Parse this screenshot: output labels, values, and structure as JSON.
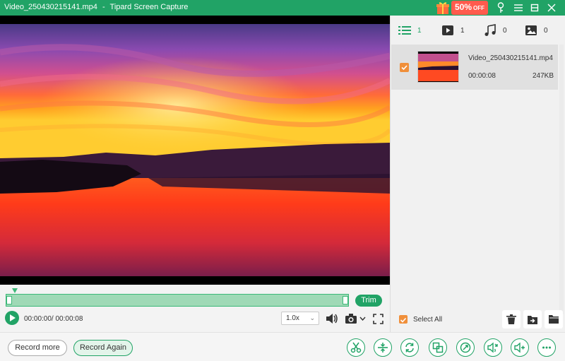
{
  "window": {
    "file_name": "Video_250430215141.mp4",
    "separator": "-",
    "app_name": "Tipard Screen Capture",
    "promo_text": "50%",
    "promo_suffix": "OFF",
    "accent_color": "#21a366"
  },
  "player": {
    "time_display": "00:00:00/ 00:00:08",
    "speed": "1.0x",
    "trim_label": "Trim"
  },
  "panel": {
    "tabs": [
      {
        "icon": "list-icon",
        "count": "1"
      },
      {
        "icon": "video-icon",
        "count": "1"
      },
      {
        "icon": "music-icon",
        "count": "0"
      },
      {
        "icon": "image-icon",
        "count": "0"
      }
    ],
    "files": [
      {
        "name": "Video_250430215141.mp4",
        "duration": "00:00:08",
        "size": "247KB",
        "checked": true
      }
    ],
    "select_all_label": "Select All"
  },
  "bottom": {
    "record_more": "Record more",
    "record_again": "Record Again",
    "tools": [
      "scissors-icon",
      "split-icon",
      "convert-icon",
      "merge-icon",
      "compress-icon",
      "volume-boost-icon",
      "audio-add-icon",
      "more-icon"
    ]
  }
}
